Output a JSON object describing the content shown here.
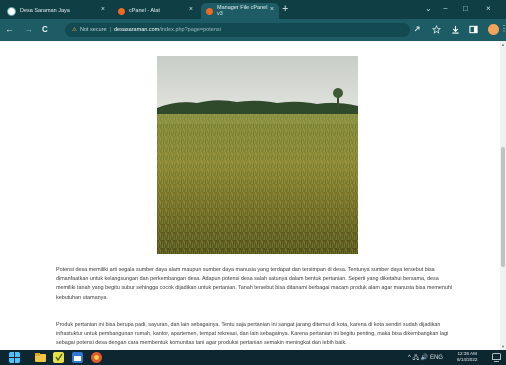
{
  "browser": {
    "tabs": [
      {
        "label": "Desa Saraman Jaya",
        "favicon_color": "#ffffff",
        "active": false
      },
      {
        "label": "cPanel - Alat",
        "favicon_color": "#f26a21",
        "active": false
      },
      {
        "label": "Manager File cPanel v3",
        "favicon_color": "#f26a21",
        "active": true
      }
    ],
    "new_tab": "+",
    "window_controls": {
      "dropdown": "⌄",
      "minimize": "−",
      "maximize": "□",
      "close": "×"
    },
    "nav": {
      "back": "←",
      "forward": "→",
      "reload": "C"
    },
    "address": {
      "warning_icon": "⚠",
      "security_label": "Not secure",
      "separator": "|",
      "host": "desasaraman.com",
      "path": "/index.php?page=potensi"
    },
    "toolbar_icons": [
      "share-icon",
      "star-icon",
      "download-icon",
      "sidebar-icon",
      "profile-avatar",
      "menu-icon"
    ]
  },
  "page": {
    "paragraphs": [
      "Potensi desa memiliki arti segala sumber daya alam maupun sumber daya manusia yang terdapat dan tersimpan di desa. Tentunya sumber daya tersebut bisa dimanfaatkan untuk kelangsungan dan perkembangan desa. Adapun potensi desa salah satunya dalam bentuk pertanian. Seperti yang diketahui bersama, desa memiliki tanah yang begitu subur sehingga cocok dijadikan untuk pertanian. Tanah tersebut bisa ditanami berbagai macam produk alam agar manusia bisa memenuhi kebutuhan utamanya.",
      "Produk pertanian ini bisa berupa padi, sayuran, dan lain sebagainya. Tentu saja pertanian ini sangat jarang ditemui di kota, karena di kota sendiri sudah dijadikan infrastuktur untuk pembangunan rumah, kantor, apartemen, tempat rekreasi, dan lain sebagainya. Karena pertanian ini begitu penting, maka bisa dikembangkan lagi sebagai potensi desa dengan cara membentuk komunitas tani agar produksi pertanian semakin meningkat dan lebih baik."
    ]
  },
  "taskbar": {
    "icons": [
      "windows-icon",
      "file-explorer-icon",
      "app-icon",
      "calendar-icon",
      "browser-icon"
    ],
    "tray_text": "^ 🖧 🔊 ENG",
    "time": "12:35 AM",
    "date": "6/14/2022"
  }
}
